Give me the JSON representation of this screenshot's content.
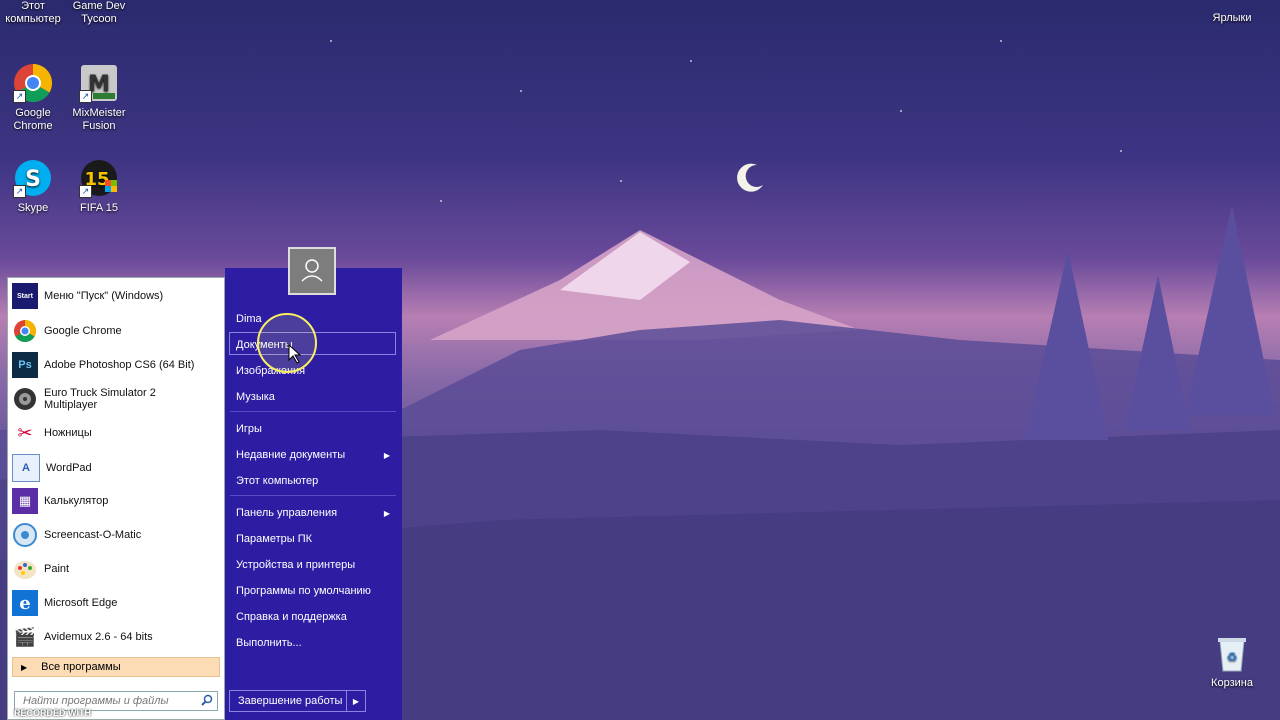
{
  "desktop": {
    "icons": [
      {
        "label": "Этот компьютер"
      },
      {
        "label": "Game Dev Tycoon"
      },
      {
        "label": "Google Chrome"
      },
      {
        "label": "MixMeister Fusion"
      },
      {
        "label": "Skype"
      },
      {
        "label": "FIFA 15"
      },
      {
        "label": "Ярлыки"
      },
      {
        "label": "Корзина"
      }
    ]
  },
  "start_menu": {
    "programs": [
      {
        "label": "Меню \"Пуск\" (Windows)",
        "icon": "start-menu-icon"
      },
      {
        "label": "Google Chrome",
        "icon": "chrome-icon"
      },
      {
        "label": "Adobe Photoshop CS6 (64 Bit)",
        "icon": "photoshop-icon"
      },
      {
        "label": "Euro Truck Simulator 2 Multiplayer",
        "icon": "ets2-icon"
      },
      {
        "label": "Ножницы",
        "icon": "scissors-icon"
      },
      {
        "label": "WordPad",
        "icon": "wordpad-icon"
      },
      {
        "label": "Калькулятор",
        "icon": "calculator-icon"
      },
      {
        "label": "Screencast-O-Matic",
        "icon": "screencast-icon"
      },
      {
        "label": "Paint",
        "icon": "paint-icon"
      },
      {
        "label": "Microsoft Edge",
        "icon": "edge-icon"
      },
      {
        "label": "Avidemux 2.6 - 64 bits",
        "icon": "avidemux-icon"
      }
    ],
    "all_programs": "Все программы",
    "search_placeholder": "Найти программы и файлы",
    "right": {
      "user": "Dima",
      "documents": "Документы",
      "images": "Изображения",
      "music": "Музыка",
      "games": "Игры",
      "recent": "Недавние документы",
      "computer": "Этот компьютер",
      "control_panel": "Панель управления",
      "pc_settings": "Параметры ПК",
      "devices": "Устройства и принтеры",
      "default_programs": "Программы по умолчанию",
      "help": "Справка и поддержка",
      "run": "Выполнить..."
    },
    "shutdown": "Завершение работы"
  },
  "watermark": "RECORDED WITH",
  "colors": {
    "menu_accent": "#2d1da3",
    "all_programs_bg": "#fbdcb4"
  }
}
